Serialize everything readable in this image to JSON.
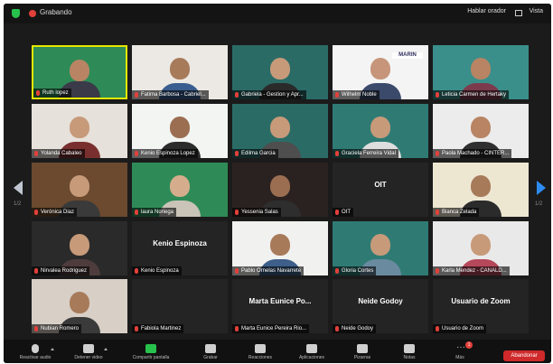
{
  "topbar": {
    "recording_label": "Grabando",
    "speaker_view_label": "Hablar orador",
    "view_label": "Vista"
  },
  "pager": {
    "left": "1/2",
    "right": "1/2"
  },
  "tiles": [
    {
      "name": "Ruth lopez",
      "video": true,
      "active": true,
      "bg": "#2e8b57",
      "skin": "#b88463",
      "shirt": "#3a3a48"
    },
    {
      "name": "Fatima Barbosa - Cabriel...",
      "video": true,
      "bg": "#ece9e4",
      "skin": "#a77a5a",
      "shirt": "#3a5d8f"
    },
    {
      "name": "Gabriela - Gestion y Apr...",
      "video": true,
      "bg": "#2b6b66",
      "skin": "#c79a7a",
      "shirt": "#2a2a2a"
    },
    {
      "name": "Wilhelm Noble",
      "video": true,
      "bg": "#f4f4f4",
      "skin": "#c7957a",
      "shirt": "#3b4a6b",
      "banner": "MARIN"
    },
    {
      "name": "Leticia Carmen de Hertaky",
      "video": true,
      "bg": "#3a8f8a",
      "skin": "#b88463",
      "shirt": "#7c3b4c"
    },
    {
      "name": "Yolanda Cabaleo",
      "video": true,
      "bg": "#e6e1da",
      "skin": "#c79a7a",
      "shirt": "#7a2f2f"
    },
    {
      "name": "Kenio Espinoza Lopez",
      "video": true,
      "bg": "#f2f5f2",
      "skin": "#9b6e52",
      "shirt": "#2c2c2c"
    },
    {
      "name": "Edilma Garcia",
      "video": true,
      "bg": "#2b6b66",
      "skin": "#c79a7a",
      "shirt": "#4e4e4e"
    },
    {
      "name": "Graciela Ferreira Vidal",
      "video": true,
      "bg": "#2f7b74",
      "skin": "#c79a7a",
      "shirt": "#dedede"
    },
    {
      "name": "Paola Machado - CINTER...",
      "video": true,
      "bg": "#ececec",
      "skin": "#b88463",
      "shirt": "#2f2f2f"
    },
    {
      "name": "Verónica Diaz",
      "video": true,
      "bg": "#6b4a2f",
      "skin": "#c79a7a",
      "shirt": "#3a3a3a"
    },
    {
      "name": "laura Noriega",
      "video": true,
      "bg": "#2e8b57",
      "skin": "#d6ad8c",
      "shirt": "#c9c3b8"
    },
    {
      "name": "Yessenia Salas",
      "video": true,
      "bg": "#2a2220",
      "skin": "#9b6e52",
      "shirt": "#2e2e2e"
    },
    {
      "name": "OIT",
      "video": false,
      "center": "OIT"
    },
    {
      "name": "Bianca Zelada",
      "video": true,
      "bg": "#ede7d2",
      "skin": "#a77a5a",
      "shirt": "#2b2b2b"
    },
    {
      "name": "Nirvalea Rodriguez",
      "video": true,
      "bg": "#2a2a2a",
      "skin": "#c79a7a",
      "shirt": "#4e3c3c"
    },
    {
      "name": "Kenio Espinoza",
      "video": false,
      "center": "Kenio Espinoza"
    },
    {
      "name": "Pablo Ornelas Navarrete",
      "video": true,
      "bg": "#f1f1ef",
      "skin": "#a77a5a",
      "shirt": "#3d5f8a"
    },
    {
      "name": "Gloria Cortes",
      "video": true,
      "bg": "#2f7b74",
      "skin": "#c79a7a",
      "shirt": "#6a8aa0"
    },
    {
      "name": "Karla Mendez - CANALD...",
      "video": true,
      "bg": "#e9e9e9",
      "skin": "#c79a7a",
      "shirt": "#b5485a"
    },
    {
      "name": "Nubian Romero",
      "video": true,
      "bg": "#d8cfc6",
      "skin": "#a77a5a",
      "shirt": "#3a3a3a"
    },
    {
      "name": "Fabiola Martinez",
      "video": false,
      "center": ""
    },
    {
      "name": "Marta Eunice Pereira Rio...",
      "video": false,
      "center": "Marta Eunice Po..."
    },
    {
      "name": "Neide Godoy",
      "video": false,
      "center": "Neide Godoy"
    },
    {
      "name": "Usuario de Zoom",
      "video": false,
      "center": "Usuario de Zoom"
    }
  ],
  "toolbar": [
    {
      "name": "unmute-button",
      "label": "Reactivar audio",
      "icon": "microphone-off-icon"
    },
    {
      "name": "start-video-button",
      "label": "Detener video",
      "icon": "camera-icon"
    },
    {
      "name": "share-screen-button",
      "label": "Compartir pantalla",
      "icon": "share-screen-icon"
    },
    {
      "name": "record-button",
      "label": "Grabar",
      "icon": "record-icon"
    },
    {
      "name": "reactions-button",
      "label": "Reacciones",
      "icon": "sparkle-icon"
    },
    {
      "name": "apps-button",
      "label": "Aplicaciones",
      "icon": "apps-icon"
    },
    {
      "name": "whiteboard-button",
      "label": "Pizarras",
      "icon": "whiteboard-icon"
    },
    {
      "name": "notes-button",
      "label": "Notas",
      "icon": "notes-icon"
    },
    {
      "name": "more-button",
      "label": "Más",
      "icon": "more-icon"
    }
  ],
  "more_badge": "1",
  "end_button": "Abandonar",
  "colors": {
    "red": "#e2403a",
    "green": "#27c24c",
    "end": "#d0292b",
    "active_border": "#e6e600"
  }
}
